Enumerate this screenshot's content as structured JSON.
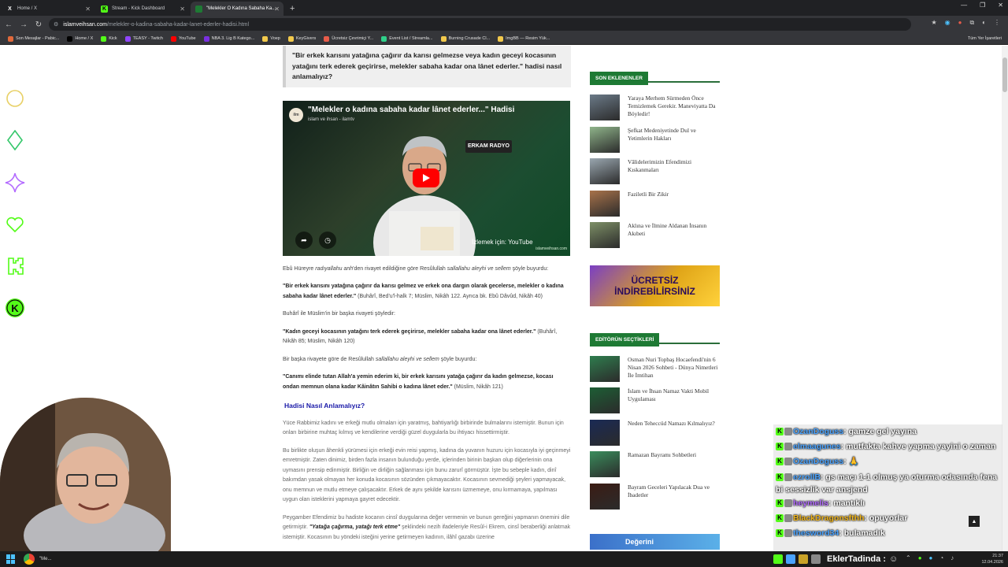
{
  "browser": {
    "tabs": [
      {
        "label": "Home / X",
        "fav": "X",
        "favcolor": "#000000"
      },
      {
        "label": "Stream - Kick Dashboard",
        "fav": "K",
        "favcolor": "#53fc18"
      },
      {
        "label": "\"Melekler O Kadına Sabaha Ka...",
        "fav": "",
        "favcolor": "#1e7a34"
      }
    ],
    "url_domain": "islamveihsan.com",
    "url_path": "/melekler-o-kadina-sabaha-kadar-lanet-ederler-hadisi.html",
    "bookmarks": [
      {
        "label": "Son Mesajlar - Pabic...",
        "color": "#e0693b"
      },
      {
        "label": "Home / X",
        "color": "#000000"
      },
      {
        "label": "Kick",
        "color": "#53fc18"
      },
      {
        "label": "TEASY - Twitch",
        "color": "#9146ff"
      },
      {
        "label": "YouTube",
        "color": "#ff0000"
      },
      {
        "label": "NBA 3. Lig B Katego...",
        "color": "#7a2fe0"
      },
      {
        "label": "Voep",
        "color": "#f2c94c"
      },
      {
        "label": "KeyGivers",
        "color": "#f2c94c"
      },
      {
        "label": "Ücretsiz Çevrimiçi Y...",
        "color": "#e85c4a"
      },
      {
        "label": "Event List / Streamla...",
        "color": "#2fd08a"
      },
      {
        "label": "Burning Crusade Cl...",
        "color": "#f2c94c"
      },
      {
        "label": "ImgBB — Resim Yük...",
        "color": "#f2c94c"
      }
    ],
    "all_bookmarks": "Tüm Yer İşaretleri"
  },
  "article": {
    "quote_box": "\"Bir erkek karısını yatağına çağırır da karısı gelmezse veya kadın geceyi kocasının yatağını terk ederek geçirirse, melekler sabaha kadar ona lânet ederler.\" hadisi nasıl anlamalıyız?",
    "video_title": "\"Melekler o kadına sabaha kadar lânet ederler...\" Hadisi",
    "video_channel": "islam ve ihsan - ilamtv",
    "video_erkam": "ERKAM RADYO",
    "video_youtube": "İzlemek için: YouTube",
    "video_watermark": "islamveihsan.com",
    "p1_a": "Ebû Hüreyre ",
    "p1_b": "radıyallahu anh",
    "p1_c": "'den rivayet edildiğine göre Resûlullah ",
    "p1_d": "sallallahu aleyhi ve sellem",
    "p1_e": " şöyle buyurdu:",
    "q1": "\"Bir erkek karısını yatağına çağırır da karısı gelmez ve erkek ona dargın olarak gecelerse, melekler o kadına sabaha kadar lânet ederler.\"",
    "q1_src": " (Buhârî, Bed'u'l-halk 7; Müslim, Nikâh 122. Ayrıca bk. Ebû Dâvûd, Nikâh 40)",
    "p2": "Buhârî ile Müslim'in bir başka rivayeti şöyledir:",
    "q2": "\"Kadın geceyi kocasının yatağını terk ederek geçirirse, melekler sabaha kadar ona lânet ederler.\"",
    "q2_src": " (Buhârî, Nikâh 85; Müslim, Nikâh 120)",
    "p3_a": "Bir başka rivayete göre de Resûlullah ",
    "p3_b": "sallallahu aleyhi ve sellem",
    "p3_c": " şöyle buyurdu:",
    "q3": "\"Canımı elinde tutan Allah'a yemin ederim ki, bir erkek karısını yatağa çağırır da kadın gelmezse, kocası ondan memnun olana kadar Kâinâtın Sahibi o kadına lânet eder.\"",
    "q3_src": " (Müslim, Nikâh 121)",
    "h3": "Hadisi Nasıl Anlamalıyız?",
    "p4": "Yüce Rabbimiz kadını ve erkeği mutlu olmaları için yaratmış, bahtiyarlığı birbirinde bulmalarını istemiştir. Bunun için onları birbirine muhtaç kılmış ve kendilerine verdiği güzel duygularla bu ihtiyacı hissettirmiştir.",
    "p5": "Bu birlikte oluşun âhenkli yürümesi için erkeği evin reisi yapmış, kadına da yuvanın huzuru için kocasıyla iyi geçinmeyi emretmiştir. Zaten dinimiz, birden fazla insanın bulunduğu yerde, içlerinden birinin başkan olup diğerlerinin ona uymasını prensip edinmiştir. Birliğin ve dirliğin sağlanması için bunu zarurî görmüştür. İşte bu sebeple kadın, dinî bakımdan yasak olmayan her konuda kocasının sözünden çıkmayacaktır. Kocasının sevmediği şeyleri yapmayacak, onu memnun ve mutlu etmeye çalışacaktır. Erkek de aynı şekilde karısını üzmemeye, onu kırmamaya, yapılması uygun olan isteklerini yapmaya gayret edecektir.",
    "p6_a": "Peygamber Efendimiz bu hadiste kocanın cinsî duygularına değer vermenin ve bunun gereğini yapmanın önemini dile getirmiştir. ",
    "p6_b": "\"Yatağa çağırma, yatağı terk etme\"",
    "p6_c": " şeklindeki nezih ifadeleriyle Resûl-i Ekrem, cinsî beraberliği anlatmak istemiştir. Kocasının bu yöndeki isteğini yerine getirmeyen kadının, ilâhî gazabı üzerine"
  },
  "sidebar": {
    "recent_heading": "SON EKLENENLER",
    "recent": [
      {
        "title": "Yaraya Merhem Sürmeden Önce Temizlemek Gerekir. Maneviyatta Da Böyledir!",
        "thumb": "#6b7a88"
      },
      {
        "title": "Şefkat Medeniyetinde Dul ve Yetimlerin Hakları",
        "thumb": "#8fb48a"
      },
      {
        "title": "Vâlidelerimizin Efendimizi Kıskanmaları",
        "thumb": "#9aa7b0"
      },
      {
        "title": "Faziletli Bir Zikir",
        "thumb": "#a8724a"
      },
      {
        "title": "Aklına ve İlmine Aldanan İnsanın Akıbeti",
        "thumb": "#7d8f66"
      }
    ],
    "banner_line1": "ÜCRETSİZ",
    "banner_line2": "İNDİREBİLİRSİNİZ",
    "editor_heading": "EDİTÖRÜN SEÇTİKLERİ",
    "editor": [
      {
        "title": "Osman Nuri Topbaş Hocaefendi'nin 6 Nisan 2026 Sohbeti - Dünya Nimetleri İle İmtihan",
        "thumb": "#2f7d4e"
      },
      {
        "title": "İslam ve İhsan Namaz Vakti Mobil Uygulaması",
        "thumb": "#1d5e35"
      },
      {
        "title": "Neden Teheccüd Namazı Kılmalıyız?",
        "thumb": "#1a2a55"
      },
      {
        "title": "Ramazan Bayramı Sohbetleri",
        "thumb": "#3a8d5c"
      },
      {
        "title": "Bayram Geceleri Yapılacak Dua ve İbadetler",
        "thumb": "#3b1c14"
      }
    ],
    "bottom_banner": "Değerini"
  },
  "chat": {
    "lines": [
      {
        "user": "OzanDoguss",
        "color": "#4aa3ff",
        "msg": ": gamze gel yayına"
      },
      {
        "user": "elmaagunes",
        "color": "#4aa3ff",
        "msg": ": mutfakta kahve yapma yayini o zaman"
      },
      {
        "user": "OzanDoguss",
        "color": "#4aa3ff",
        "msg": ": 🙏"
      },
      {
        "user": "ezrollB",
        "color": "#4aa3ff",
        "msg": ": gs maçı 1-1 olmuş ya oturma odasında fena bi sessizlik var ansjend"
      },
      {
        "user": "heymelis",
        "color": "#b36bff",
        "msg": ": mantıklı"
      },
      {
        "user": "BlackDragonsfthh",
        "color": "#f2b61b",
        "msg": ": opuyorlar"
      },
      {
        "user": "thesword34",
        "color": "#4aa3ff",
        "msg": ": bulamadık"
      }
    ]
  },
  "taskbar": {
    "chrome_label": "\"Me...",
    "tray_name": "EklerTadinda :",
    "time": "21:37",
    "date": "12.04.2026"
  }
}
